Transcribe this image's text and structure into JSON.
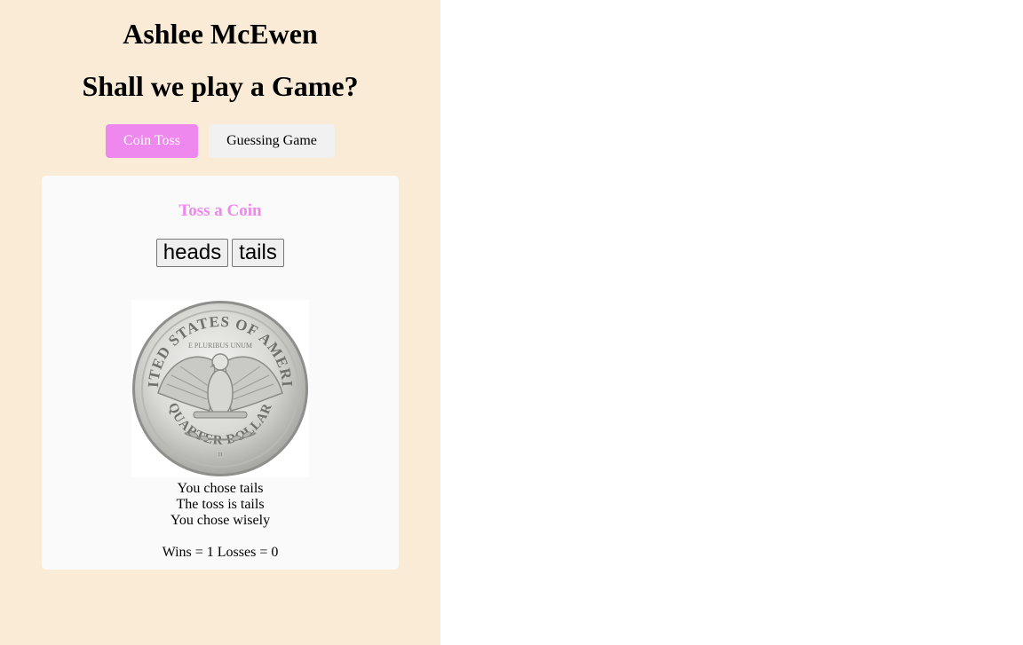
{
  "header": {
    "name": "Ashlee McEwen",
    "subtitle": "Shall we play a Game?"
  },
  "tabs": [
    {
      "label": "Coin Toss",
      "active": true
    },
    {
      "label": "Guessing Game",
      "active": false
    }
  ],
  "coin_panel": {
    "title": "Toss a Coin",
    "buttons": {
      "heads": "heads",
      "tails": "tails"
    },
    "coin_image": {
      "side": "tails",
      "lettering": {
        "top": "UNITED STATES OF AMERICA",
        "motto": "E PLURIBUS UNUM",
        "bottom": "QUARTER DOLLAR",
        "mint": "D"
      }
    },
    "result": {
      "choice": "You chose tails",
      "toss": "The toss is tails",
      "verdict": "You chose wisely"
    },
    "score": "Wins = 1 Losses = 0"
  },
  "colors": {
    "left_background": "#faebd7",
    "accent": "#ee88ee",
    "panel_background": "#fafafa",
    "inactive_tab": "#f1f1f1"
  }
}
